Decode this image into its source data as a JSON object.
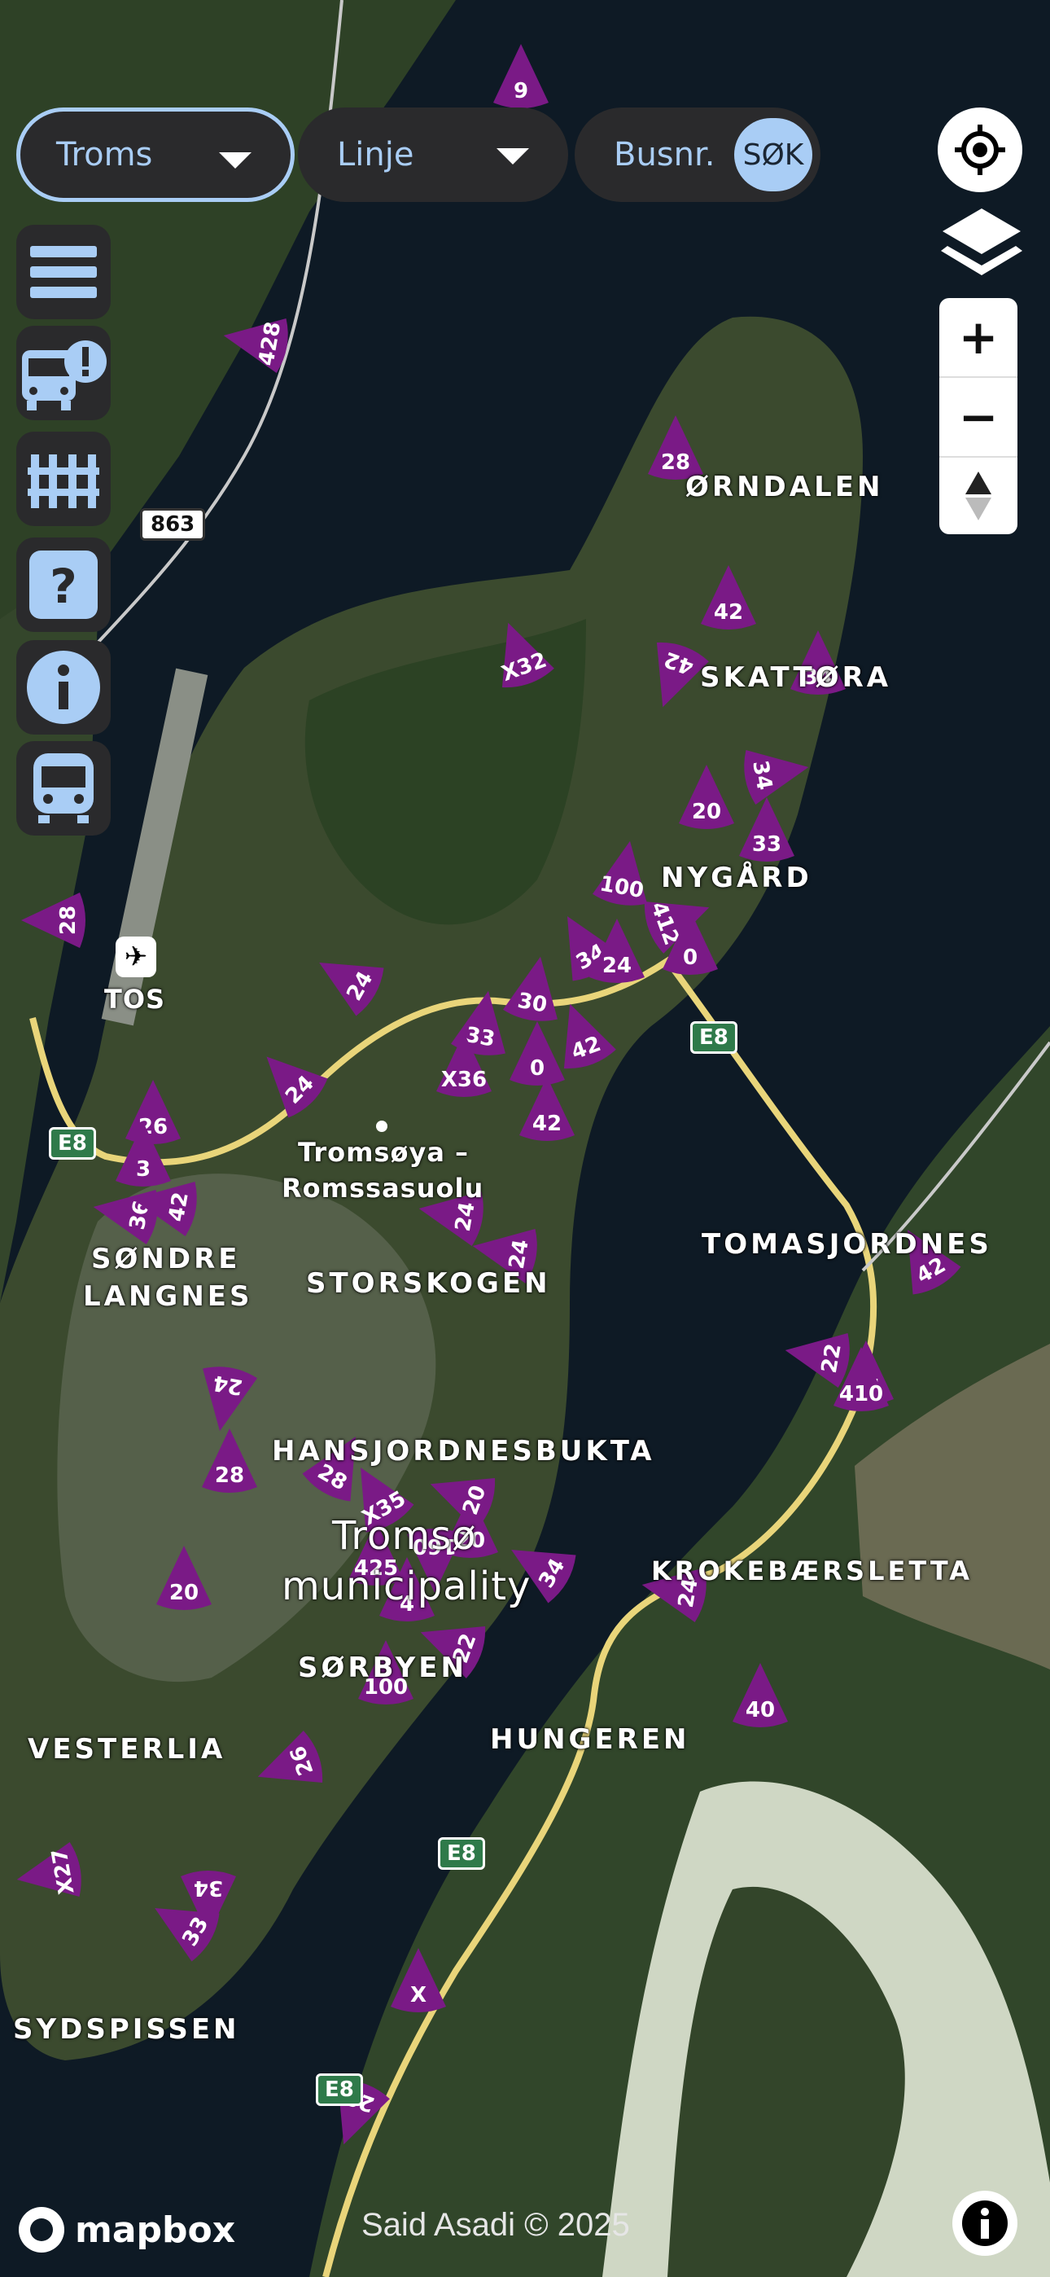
{
  "filters": {
    "region": {
      "label": "Troms"
    },
    "line": {
      "label": "Linje"
    },
    "bus_number": {
      "label": "Busnr.",
      "search_button": "SØK"
    }
  },
  "side_menu": [
    {
      "icon": "menu-icon"
    },
    {
      "icon": "bus-alert-icon"
    },
    {
      "icon": "fence-icon"
    },
    {
      "icon": "help-icon"
    },
    {
      "icon": "info-icon"
    },
    {
      "icon": "train-icon"
    }
  ],
  "map_controls": {
    "locate_icon": "locate-icon",
    "layers_icon": "layers-icon",
    "zoom_in": "+",
    "zoom_out": "−",
    "compass_icon": "compass-icon"
  },
  "places": [
    "ØRNDALEN",
    "SKATTØRA",
    "NYGÅRD",
    "TOS",
    "SØNDRE",
    "LANGNES",
    "STORSKOGEN",
    "TOMASJORDNES",
    "HANSJORDNESBUKTA",
    "Tromsø",
    "municipality",
    "KROKEBÆRSLETTA",
    "SØRBYEN",
    "VESTERLIA",
    "HUNGEREN",
    "SYDSPISSEN",
    "Tromsøya –",
    "Romssasuolu"
  ],
  "road_shields": [
    "E8",
    "E8",
    "E8",
    "E8",
    "863"
  ],
  "bus_markers": [
    "428",
    "28",
    "42",
    "X32",
    "42",
    "34",
    "20",
    "34",
    "33",
    "100",
    "412",
    "0",
    "34",
    "30",
    "24",
    "24",
    "33",
    "42",
    "X36",
    "0",
    "42",
    "24",
    "26",
    "3",
    "36",
    "42",
    "24",
    "24",
    "42",
    "22",
    "410",
    "24",
    "28",
    "28",
    "X35",
    "20",
    "425",
    "160",
    "20",
    "4",
    "22",
    "100",
    "34",
    "24",
    "20",
    "26",
    "40",
    "X27",
    "34",
    "33",
    "X",
    "28",
    "28",
    "24",
    "9"
  ],
  "colors": {
    "marker": "#7a1a86",
    "pill_bg": "#2a2a2c",
    "accent": "#a9cdf5",
    "road": "#e9d57a"
  },
  "attribution": {
    "logo": "mapbox",
    "credit": "Said Asadi © 2025"
  }
}
